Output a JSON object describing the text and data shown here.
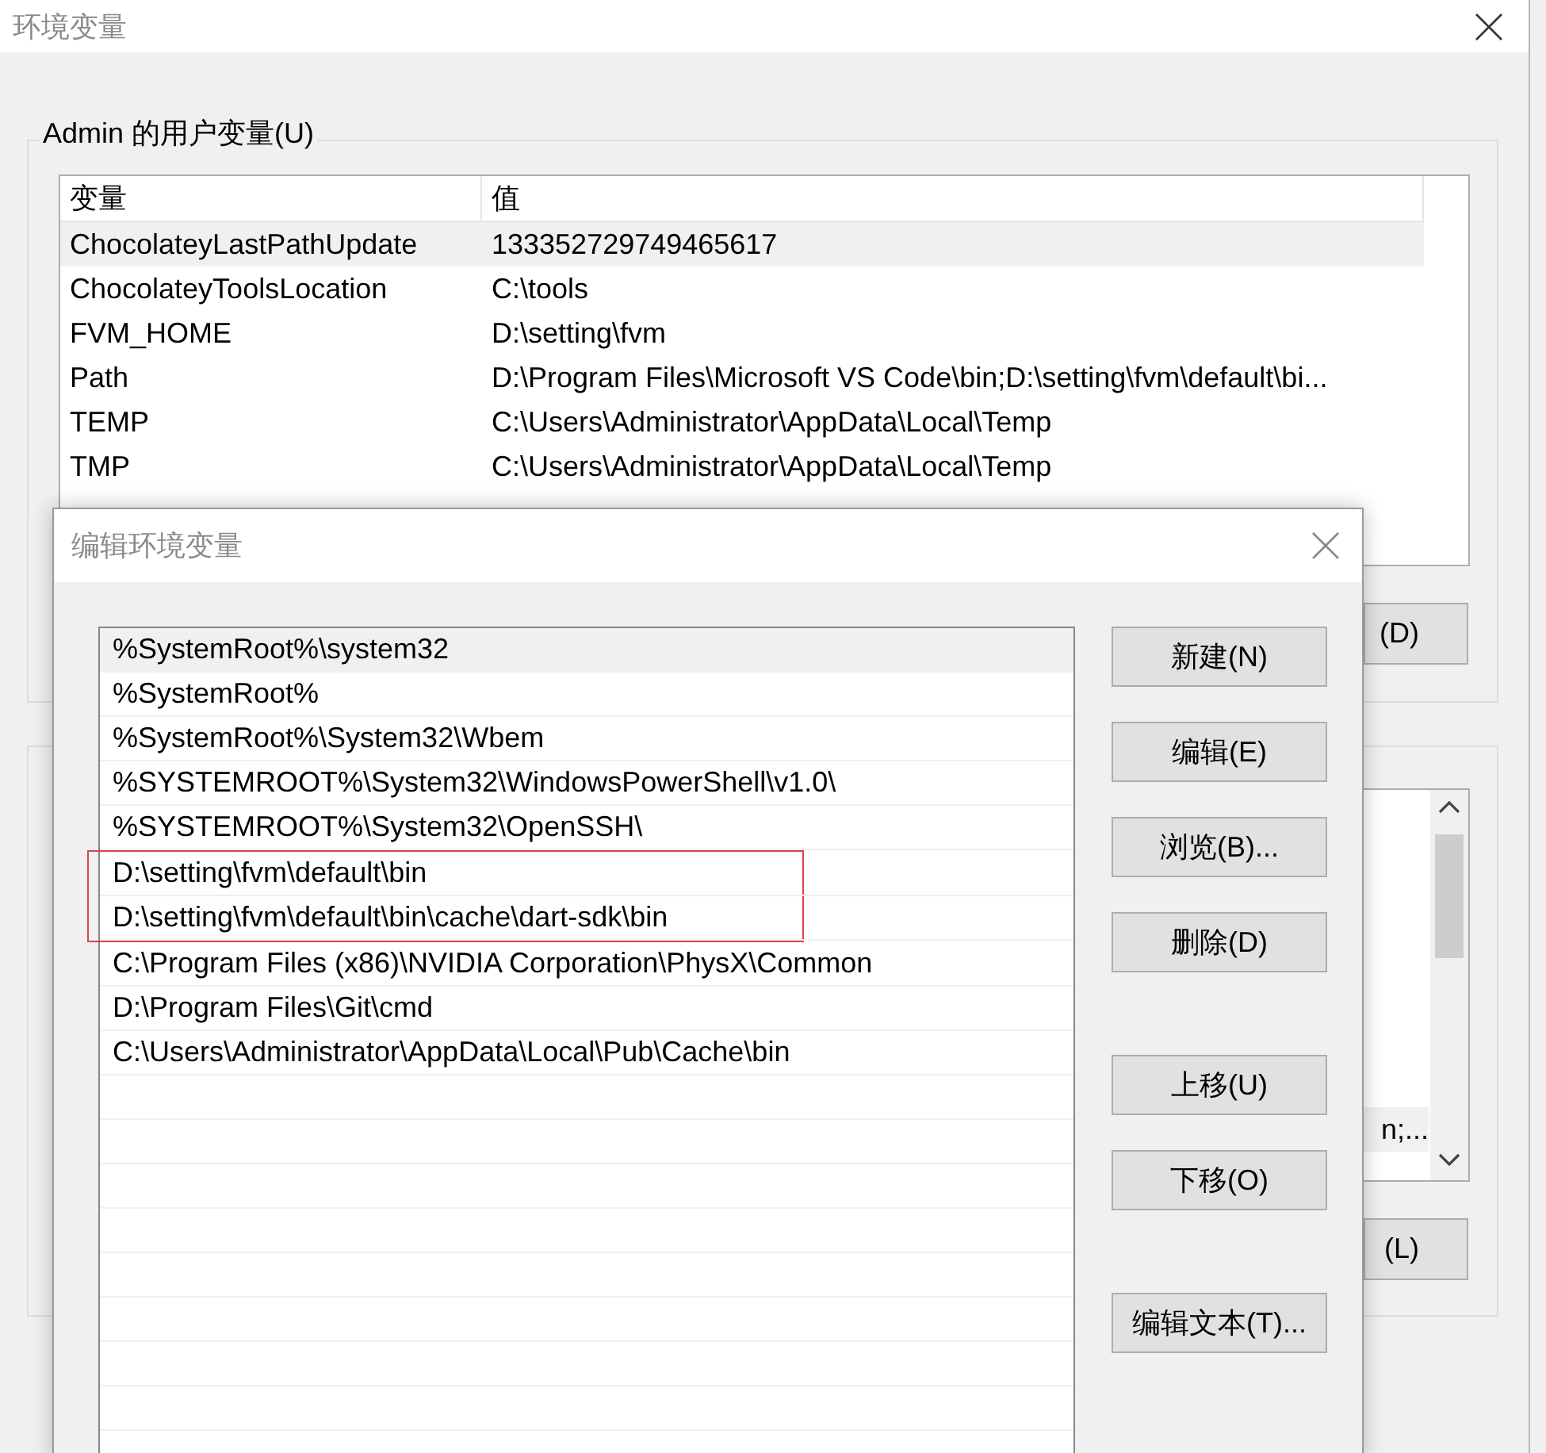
{
  "main_window": {
    "title": "环境变量",
    "user_variables": {
      "label": "Admin 的用户变量(U)",
      "columns": [
        "变量",
        "值"
      ],
      "rows": [
        {
          "name": "ChocolateyLastPathUpdate",
          "value": "133352729749465617",
          "selected": true
        },
        {
          "name": "ChocolateyToolsLocation",
          "value": "C:\\tools",
          "selected": false
        },
        {
          "name": "FVM_HOME",
          "value": "D:\\setting\\fvm",
          "selected": false
        },
        {
          "name": "Path",
          "value": "D:\\Program Files\\Microsoft VS Code\\bin;D:\\setting\\fvm\\default\\bi...",
          "selected": false
        },
        {
          "name": "TEMP",
          "value": "C:\\Users\\Administrator\\AppData\\Local\\Temp",
          "selected": false
        },
        {
          "name": "TMP",
          "value": "C:\\Users\\Administrator\\AppData\\Local\\Temp",
          "selected": false
        }
      ],
      "button": "(D)"
    },
    "system_variables": {
      "visible_cell": "n;...",
      "button": "(L)"
    }
  },
  "edit_dialog": {
    "title": "编辑环境变量",
    "entries": [
      {
        "text": "%SystemRoot%\\system32",
        "selected": true,
        "marked": false
      },
      {
        "text": "%SystemRoot%",
        "selected": false,
        "marked": false
      },
      {
        "text": "%SystemRoot%\\System32\\Wbem",
        "selected": false,
        "marked": false
      },
      {
        "text": "%SYSTEMROOT%\\System32\\WindowsPowerShell\\v1.0\\",
        "selected": false,
        "marked": false
      },
      {
        "text": "%SYSTEMROOT%\\System32\\OpenSSH\\",
        "selected": false,
        "marked": false
      },
      {
        "text": "D:\\setting\\fvm\\default\\bin",
        "selected": false,
        "marked": true
      },
      {
        "text": "D:\\setting\\fvm\\default\\bin\\cache\\dart-sdk\\bin",
        "selected": false,
        "marked": true
      },
      {
        "text": "C:\\Program Files (x86)\\NVIDIA Corporation\\PhysX\\Common",
        "selected": false,
        "marked": false
      },
      {
        "text": "D:\\Program Files\\Git\\cmd",
        "selected": false,
        "marked": false
      },
      {
        "text": "C:\\Users\\Administrator\\AppData\\Local\\Pub\\Cache\\bin",
        "selected": false,
        "marked": false
      }
    ],
    "button_groups": [
      [
        "新建(N)",
        "编辑(E)",
        "浏览(B)...",
        "删除(D)"
      ],
      [
        "上移(U)",
        "下移(O)"
      ],
      [
        "编辑文本(T)..."
      ]
    ]
  }
}
